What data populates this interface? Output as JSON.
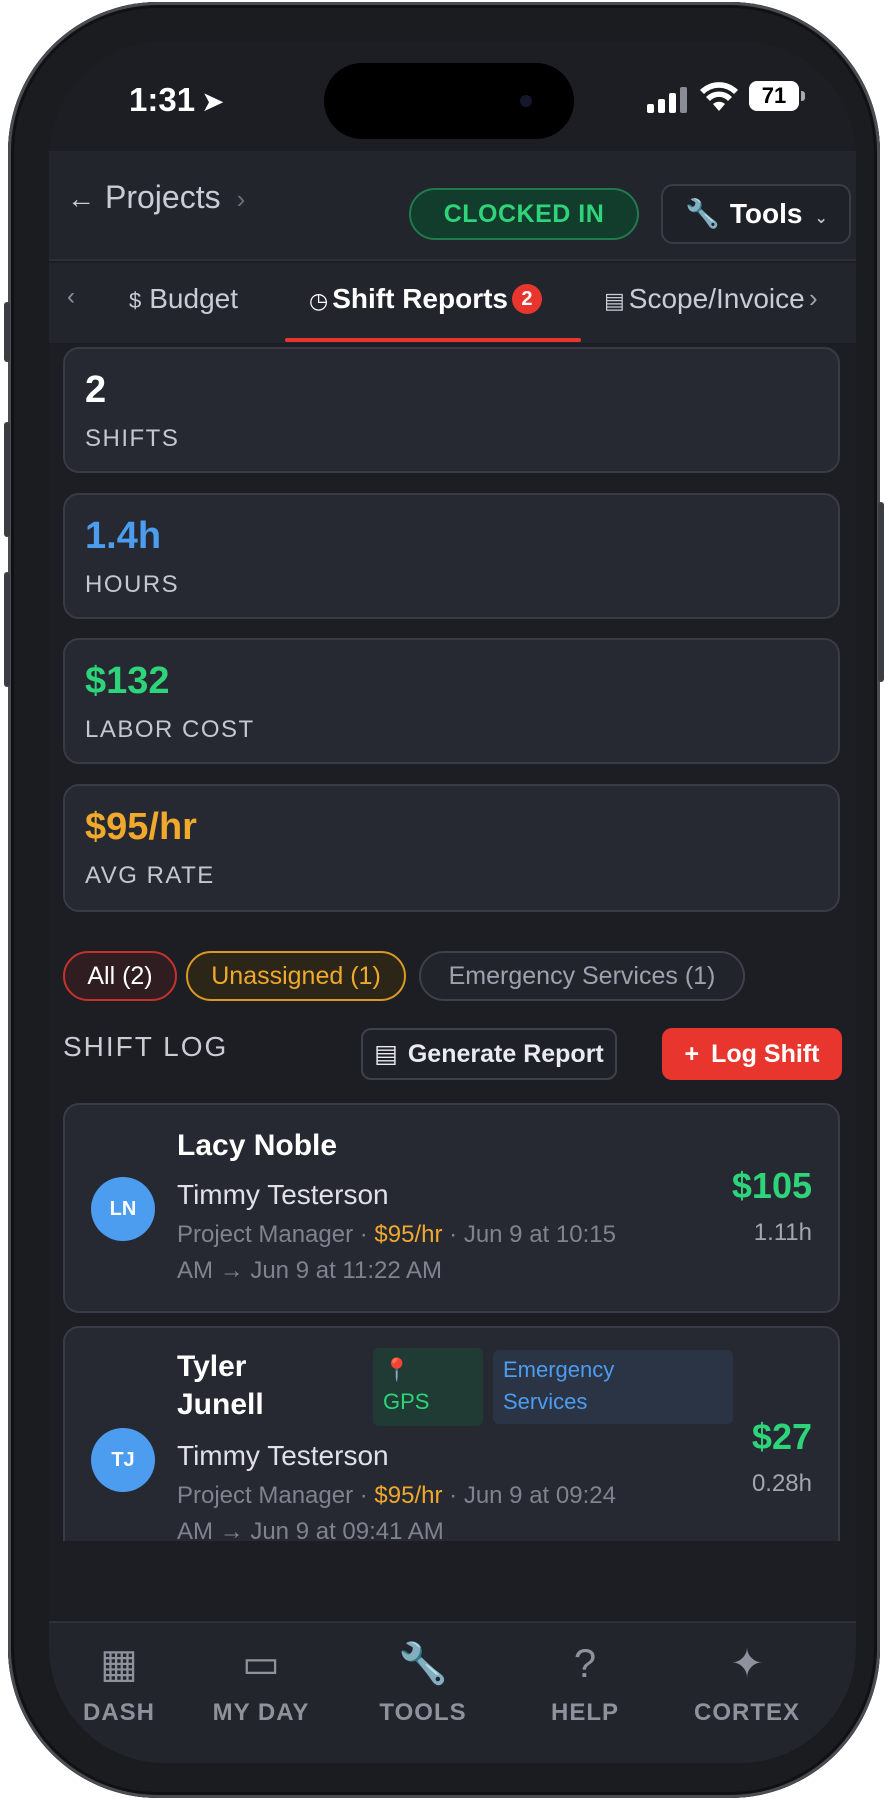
{
  "status_bar": {
    "time": "1:31",
    "battery": "71"
  },
  "header": {
    "back_label": "Projects",
    "clocked_status": "CLOCKED IN",
    "tools_label": "Tools"
  },
  "tabs": {
    "items": [
      {
        "label": "Budget",
        "icon": "dollar-icon"
      },
      {
        "label": "Shift Reports",
        "icon": "clock-icon",
        "badge": "2",
        "active": true
      },
      {
        "label": "Scope/Invoice",
        "icon": "document-icon"
      }
    ]
  },
  "stats": [
    {
      "value": "2",
      "label": "SHIFTS",
      "color": "#ffffff"
    },
    {
      "value": "1.4h",
      "label": "HOURS",
      "color": "#4c9cf0"
    },
    {
      "value": "$132",
      "label": "LABOR COST",
      "color": "#2ed47a"
    },
    {
      "value": "$95/hr",
      "label": "AVG RATE",
      "color": "#f0a92c"
    }
  ],
  "filters": [
    {
      "label": "All (2)",
      "active": true
    },
    {
      "label": "Unassigned (1)"
    },
    {
      "label": "Emergency Services (1)"
    }
  ],
  "shift_log": {
    "title": "SHIFT LOG",
    "generate_label": "Generate Report",
    "log_label": "Log Shift"
  },
  "shifts": [
    {
      "initials": "LN",
      "name": "Lacy Noble",
      "project": "Timmy Testerson",
      "role": "Project Manager",
      "rate": "$95/hr",
      "period_start": "Jun 9 at 10:15",
      "period_end": "AM → Jun 9 at 11:22 AM",
      "amount": "$105",
      "hours": "1.11h"
    },
    {
      "initials": "TJ",
      "name_line1": "Tyler",
      "name_line2": "Junell",
      "tag_gps": "GPS",
      "tag_emerg_line1": "Emergency",
      "tag_emerg_line2": "Services",
      "project": "Timmy Testerson",
      "role": "Project Manager",
      "rate": "$95/hr",
      "period_start": "Jun 9 at 09:24",
      "period_end": "AM → Jun 9 at 09:41 AM",
      "amount": "$27",
      "hours": "0.28h"
    }
  ],
  "bottom_nav": [
    {
      "label": "DASH",
      "icon": "dashboard-icon"
    },
    {
      "label": "MY DAY",
      "icon": "calendar-icon"
    },
    {
      "label": "TOOLS",
      "icon": "wrench-icon"
    },
    {
      "label": "HELP",
      "icon": "help-icon"
    },
    {
      "label": "CORTEX",
      "icon": "sparkle-icon"
    }
  ],
  "colors": {
    "accent_red": "#e8362f",
    "green": "#2ed47a",
    "blue": "#4c9cf0",
    "amber": "#f0a92c",
    "background": "#1c1e24"
  }
}
